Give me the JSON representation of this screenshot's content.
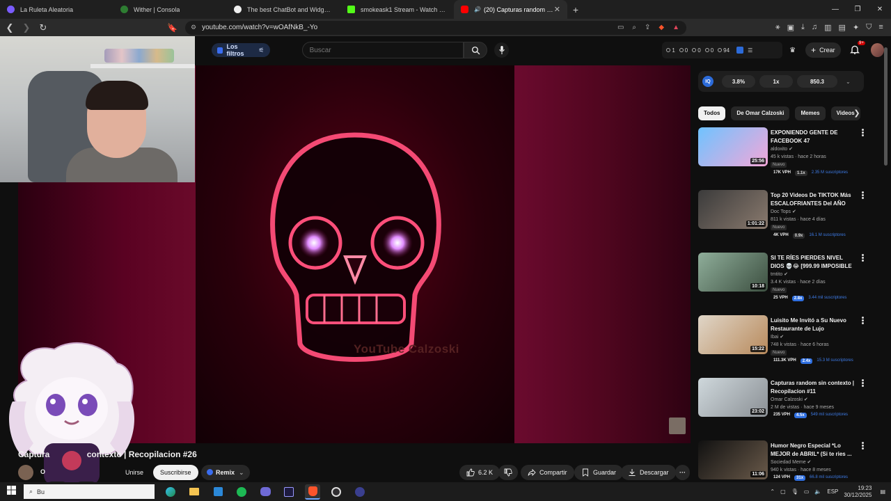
{
  "browser": {
    "tabs": [
      {
        "title": "La Ruleta Aleatoria",
        "favicon_color": "#7a5cff"
      },
      {
        "title": "Wither | Consola",
        "favicon_color": "#2e7d32"
      },
      {
        "title": "The best ChatBot and Widgets for Kick",
        "favicon_color": "#eeeeee"
      },
      {
        "title": "smokeask1 Stream - Watch Live on Kick",
        "favicon_color": "#53fc18"
      },
      {
        "title": "(20) Capturas random sin contexto",
        "favicon_color": "#ff0000"
      }
    ],
    "url": "youtube.com/watch?v=wOAfNkB_-Yo"
  },
  "youtube": {
    "filters_label": "Los filtros",
    "search_placeholder": "Buscar",
    "stats": [
      "1",
      "0",
      "0",
      "0",
      "94"
    ],
    "create_label": "Crear",
    "notif_badge": "9+"
  },
  "video": {
    "watermark": "YouTube Calzoski",
    "title_visible_left": "Captura",
    "title_visible_right": "contexto | Recopilacion #26",
    "channel_initial": "O",
    "join_label": "Unirse",
    "subscribe_label": "Suscribirse",
    "remix_label": "Remix",
    "likes": "6.2 K",
    "share_label": "Compartir",
    "save_label": "Guardar",
    "download_label": "Descargar"
  },
  "extension": {
    "logo": "IQ",
    "values": [
      "3.8%",
      "1x",
      "850.3"
    ]
  },
  "chips": [
    "Todos",
    "De Omar Calzoski",
    "Memes",
    "Videos"
  ],
  "recommendations": [
    {
      "title": "EXPONIENDO GENTE DE FACEBOOK 47",
      "channel": "aldoxito",
      "meta": "45 k vistas · hace 2 horas",
      "duration": "25:56",
      "new": "Nuevo",
      "vph": "17K VPH",
      "mult": "1.1x",
      "hot": false,
      "subs": "2.35 M suscriptores",
      "thumb": "linear-gradient(135deg,#6fc3ff,#f3a7d8)"
    },
    {
      "title": "Top 20 Videos De TIKTOK Más ESCALOFRIANTES Del AÑO",
      "channel": "Doc Tops",
      "meta": "811 k vistas · hace 4 días",
      "duration": "1:01:22",
      "new": "Nuevo",
      "vph": "4K VPH",
      "mult": "0.9x",
      "hot": false,
      "subs": "16.1 M suscriptores",
      "thumb": "linear-gradient(135deg,#3b3b3b,#8a7a6e)"
    },
    {
      "title": "SI TE RÍES PIERDES NIVEL DIOS 💀😂 [999.99 IMPOSIBLE NO ...",
      "channel": "tmtito",
      "meta": "3.4 K vistas · hace 2 días",
      "duration": "10:18",
      "new": "Nuevo",
      "vph": "25 VPH",
      "mult": "2.8x",
      "hot": true,
      "subs": "3.44 mil suscriptores",
      "thumb": "linear-gradient(135deg,#8fae9a,#3c4f40)"
    },
    {
      "title": "Luisito Me Invitó a Su Nuevo Restaurante de Lujo",
      "channel": "Ibai",
      "meta": "748 k vistas · hace 6 horas",
      "duration": "15:22",
      "new": "Nuevo",
      "vph": "111.3K VPH",
      "mult": "2.4x",
      "hot": true,
      "subs": "15.3 M suscriptores",
      "thumb": "linear-gradient(135deg,#e0d6c8,#b88a5c)"
    },
    {
      "title": "Capturas random sin contexto | Recopilacion #11",
      "channel": "Omar Calzoski",
      "meta": "2 M de vistas · hace 9 meses",
      "duration": "23:02",
      "new": "",
      "vph": "235 VPH",
      "mult": "4.5x",
      "hot": true,
      "subs": "549 mil suscriptores",
      "thumb": "linear-gradient(135deg,#cfd8dc,#8a8f94)"
    },
    {
      "title": "Humor Negro Especial *Lo MEJOR de ABRIL* (Si te ries ...",
      "channel": "Sociedad Meme",
      "meta": "940 k vistas · hace 8 meses",
      "duration": "11:06",
      "new": "",
      "vph": "124 VPH",
      "mult": "31x",
      "hot": true,
      "subs": "66.8 mil suscriptores",
      "thumb": "linear-gradient(135deg,#111,#6a5a4a)"
    }
  ],
  "taskbar": {
    "search_text": "Bu",
    "lang": "ESP",
    "time": "19:23",
    "date": "30/12/2025"
  }
}
